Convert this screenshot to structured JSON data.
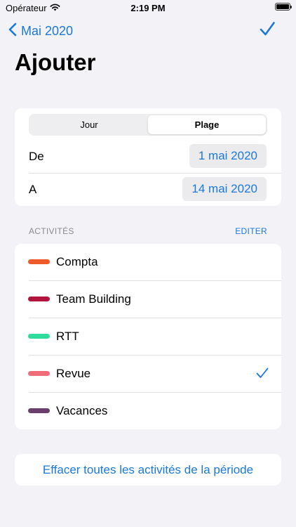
{
  "status_bar": {
    "carrier": "Opérateur",
    "time": "2:19 PM",
    "battery_level": 1.0
  },
  "nav": {
    "back_label": "Mai 2020",
    "back_icon": "chevron-left-icon",
    "done_icon": "checkmark-icon"
  },
  "title": "Ajouter",
  "mode_selector": {
    "options": [
      "Jour",
      "Plage"
    ],
    "selected": "Plage"
  },
  "range": {
    "from_label": "De",
    "from_value": "1 mai 2020",
    "to_label": "A",
    "to_value": "14 mai 2020"
  },
  "activities_section": {
    "title": "ACTIVITÉS",
    "edit_label": "EDITER"
  },
  "activities": [
    {
      "label": "Compta",
      "color": "#ef5a2a",
      "selected": false
    },
    {
      "label": "Team Building",
      "color": "#b3143f",
      "selected": false
    },
    {
      "label": "RTT",
      "color": "#2fdc9c",
      "selected": false
    },
    {
      "label": "Revue",
      "color": "#f06d7a",
      "selected": true
    },
    {
      "label": "Vacances",
      "color": "#6a3f6e",
      "selected": false
    }
  ],
  "clear_button": {
    "label": "Effacer toutes les activités de la période"
  },
  "colors": {
    "accent": "#1a78d9",
    "background": "#f2f2f7"
  }
}
